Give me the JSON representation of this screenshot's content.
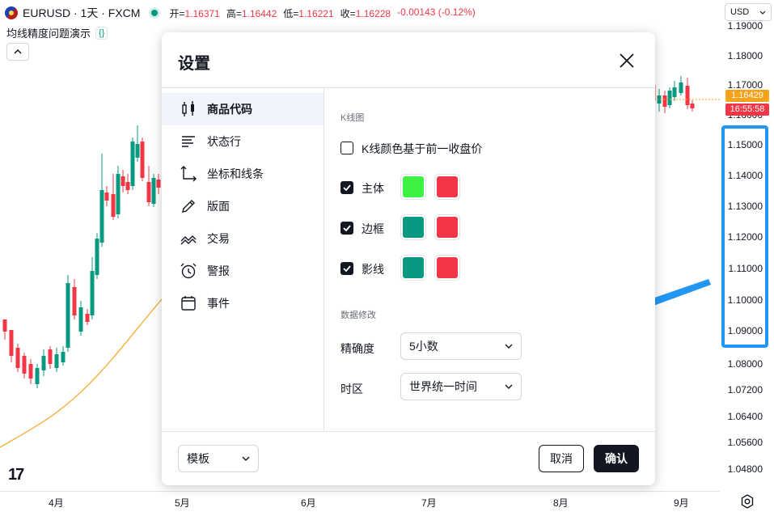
{
  "header": {
    "symbol": "EURUSD · 1天 · FXCM",
    "ohlc": [
      {
        "label": "开=",
        "value": "1.16371"
      },
      {
        "label": "高=",
        "value": "1.16442"
      },
      {
        "label": "低=",
        "value": "1.16221"
      },
      {
        "label": "收=",
        "value": "1.16228"
      },
      {
        "label": "",
        "value": "-0.00143 (-0.12%)"
      }
    ],
    "indicator_name": "均线精度问题演示",
    "indicator_badge": "{}",
    "currency": "USD"
  },
  "price_axis": {
    "ticks": [
      "1.19000",
      "1.18000",
      "1.17000",
      "1.16000",
      "1.15000",
      "1.14000",
      "1.13000",
      "1.12000",
      "1.11000",
      "1.10000",
      "1.09000",
      "1.08000",
      "1.07200",
      "1.06400",
      "1.05600",
      "1.04800"
    ],
    "current_price": "1.16429",
    "countdown": "16:55:58"
  },
  "time_axis": {
    "labels": [
      "4月",
      "5月",
      "6月",
      "7月",
      "8月",
      "9月"
    ]
  },
  "logo": "17",
  "colors": {
    "up": "#089981",
    "down": "#f23645",
    "highlight": "#2196f3",
    "ma_line": "#f7a21b"
  },
  "dialog": {
    "title": "设置",
    "nav": [
      {
        "label": "商品代码",
        "icon": "candles-icon"
      },
      {
        "label": "状态行",
        "icon": "status-line-icon"
      },
      {
        "label": "坐标和线条",
        "icon": "scales-icon"
      },
      {
        "label": "版面",
        "icon": "pencil-icon"
      },
      {
        "label": "交易",
        "icon": "trading-icon"
      },
      {
        "label": "警报",
        "icon": "alarm-clock-icon"
      },
      {
        "label": "事件",
        "icon": "calendar-icon"
      }
    ],
    "candles_section": "K线图",
    "prev_close_label": "K线颜色基于前一收盘价",
    "rows": [
      {
        "label": "主体",
        "up_color": "#3cf243",
        "down_color": "#f23645"
      },
      {
        "label": "边框",
        "up_color": "#089981",
        "down_color": "#f23645"
      },
      {
        "label": "影线",
        "up_color": "#089981",
        "down_color": "#f23645"
      }
    ],
    "data_section": "数据修改",
    "precision_label": "精确度",
    "precision_value": "5小数",
    "timezone_label": "时区",
    "timezone_value": "世界统一时间",
    "template_label": "模板",
    "cancel_label": "取消",
    "ok_label": "确认"
  }
}
